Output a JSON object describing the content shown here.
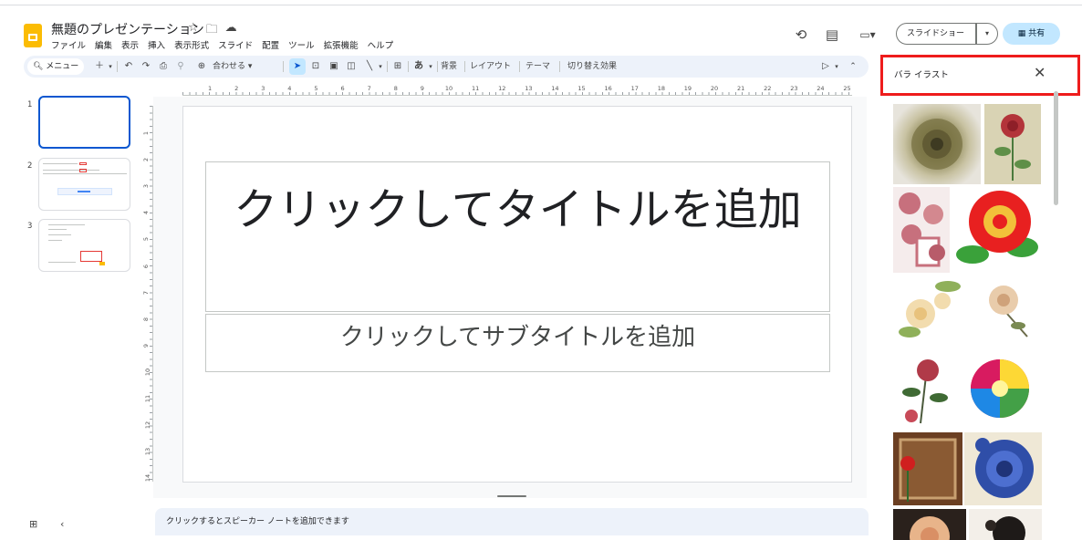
{
  "app": {
    "doc_title": "無題のプレゼンテーション",
    "menu": [
      "ファイル",
      "編集",
      "表示",
      "挿入",
      "表示形式",
      "スライド",
      "配置",
      "ツール",
      "拡張機能",
      "ヘルプ"
    ],
    "slideshow_label": "スライドショー",
    "share_label": "共有"
  },
  "toolbar": {
    "menu_search": "メニュー",
    "zoom_label": "合わせる",
    "background": "背景",
    "layout": "レイアウト",
    "theme": "テーマ",
    "transition": "切り替え効果"
  },
  "ruler": {
    "h_numbers": [
      "1",
      "2",
      "3",
      "4",
      "5",
      "6",
      "7",
      "8",
      "9",
      "10",
      "11",
      "12",
      "13",
      "14",
      "15",
      "16",
      "17",
      "18",
      "19",
      "20",
      "21",
      "22",
      "23",
      "24",
      "25"
    ],
    "v_numbers": [
      "1",
      "2",
      "3",
      "4",
      "5",
      "6",
      "7",
      "8",
      "9",
      "10",
      "11",
      "12",
      "13",
      "14"
    ]
  },
  "filmstrip": {
    "slide_numbers": [
      "1",
      "2",
      "3"
    ]
  },
  "slide": {
    "title_placeholder": "クリックしてタイトルを追加",
    "subtitle_placeholder": "クリックしてサブタイトルを追加"
  },
  "notes": {
    "placeholder": "クリックするとスピーカー ノートを追加できます"
  },
  "side_panel": {
    "search_query": "バラ イラスト",
    "images": [
      "rose-illustration-1",
      "rose-illustration-2",
      "rose-illustration-3",
      "rose-illustration-4",
      "rose-illustration-5",
      "rose-illustration-6",
      "rose-illustration-7",
      "rose-illustration-8",
      "rose-illustration-9",
      "rose-illustration-10",
      "rose-illustration-11",
      "rose-illustration-12"
    ]
  }
}
